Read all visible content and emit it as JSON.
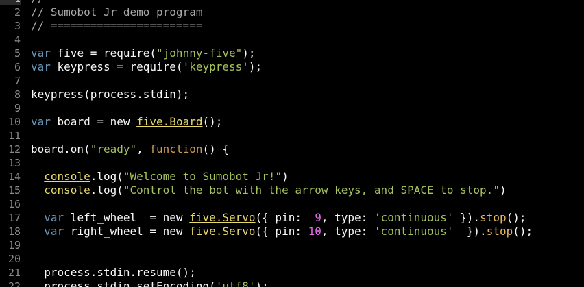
{
  "editor": {
    "lines": [
      {
        "num": "1",
        "current": true,
        "tokens": [
          {
            "text": "// =======================",
            "cls": "comment"
          }
        ]
      },
      {
        "num": "2",
        "tokens": [
          {
            "text": "// Sumobot Jr demo program",
            "cls": "comment"
          }
        ]
      },
      {
        "num": "3",
        "tokens": [
          {
            "text": "// =======================",
            "cls": "comment"
          }
        ]
      },
      {
        "num": "4",
        "tokens": []
      },
      {
        "num": "5",
        "tokens": [
          {
            "text": "var",
            "cls": "keyword"
          },
          {
            "text": " five = require(",
            "cls": "plain"
          },
          {
            "text": "\"johnny-five\"",
            "cls": "string"
          },
          {
            "text": ");",
            "cls": "plain"
          }
        ]
      },
      {
        "num": "6",
        "tokens": [
          {
            "text": "var",
            "cls": "keyword"
          },
          {
            "text": " keypress = require(",
            "cls": "plain"
          },
          {
            "text": "'keypress'",
            "cls": "string"
          },
          {
            "text": ");",
            "cls": "plain"
          }
        ]
      },
      {
        "num": "7",
        "tokens": []
      },
      {
        "num": "8",
        "tokens": [
          {
            "text": "keypress(process.stdin);",
            "cls": "plain"
          }
        ]
      },
      {
        "num": "9",
        "tokens": []
      },
      {
        "num": "10",
        "tokens": [
          {
            "text": "var",
            "cls": "keyword"
          },
          {
            "text": " board = new ",
            "cls": "plain"
          },
          {
            "text": "five.Board",
            "cls": "builtin"
          },
          {
            "text": "();",
            "cls": "plain"
          }
        ]
      },
      {
        "num": "11",
        "tokens": []
      },
      {
        "num": "12",
        "tokens": [
          {
            "text": "board.on(",
            "cls": "plain"
          },
          {
            "text": "\"ready\"",
            "cls": "string"
          },
          {
            "text": ", ",
            "cls": "plain"
          },
          {
            "text": "function",
            "cls": "func"
          },
          {
            "text": "() {",
            "cls": "plain"
          }
        ]
      },
      {
        "num": "13",
        "tokens": []
      },
      {
        "num": "14",
        "tokens": [
          {
            "text": "  ",
            "cls": "plain"
          },
          {
            "text": "console",
            "cls": "builtin"
          },
          {
            "text": ".log(",
            "cls": "plain"
          },
          {
            "text": "\"Welcome to Sumobot Jr!\"",
            "cls": "string"
          },
          {
            "text": ")",
            "cls": "plain"
          }
        ]
      },
      {
        "num": "15",
        "tokens": [
          {
            "text": "  ",
            "cls": "plain"
          },
          {
            "text": "console",
            "cls": "builtin"
          },
          {
            "text": ".log(",
            "cls": "plain"
          },
          {
            "text": "\"Control the bot with the arrow keys, and SPACE to stop.\"",
            "cls": "string"
          },
          {
            "text": ")",
            "cls": "plain"
          }
        ]
      },
      {
        "num": "16",
        "tokens": []
      },
      {
        "num": "17",
        "tokens": [
          {
            "text": "  ",
            "cls": "plain"
          },
          {
            "text": "var",
            "cls": "keyword"
          },
          {
            "text": " left_wheel  = new ",
            "cls": "plain"
          },
          {
            "text": "five.Servo",
            "cls": "builtin"
          },
          {
            "text": "({ pin:  ",
            "cls": "plain"
          },
          {
            "text": "9",
            "cls": "number"
          },
          {
            "text": ", type: ",
            "cls": "plain"
          },
          {
            "text": "'continuous'",
            "cls": "string"
          },
          {
            "text": " }).",
            "cls": "plain"
          },
          {
            "text": "stop",
            "cls": "method"
          },
          {
            "text": "();",
            "cls": "plain"
          }
        ]
      },
      {
        "num": "18",
        "tokens": [
          {
            "text": "  ",
            "cls": "plain"
          },
          {
            "text": "var",
            "cls": "keyword"
          },
          {
            "text": " right_wheel = new ",
            "cls": "plain"
          },
          {
            "text": "five.Servo",
            "cls": "builtin"
          },
          {
            "text": "({ pin: ",
            "cls": "plain"
          },
          {
            "text": "10",
            "cls": "number"
          },
          {
            "text": ", type: ",
            "cls": "plain"
          },
          {
            "text": "'continuous'",
            "cls": "string"
          },
          {
            "text": "  }).",
            "cls": "plain"
          },
          {
            "text": "stop",
            "cls": "method"
          },
          {
            "text": "();",
            "cls": "plain"
          }
        ]
      },
      {
        "num": "19",
        "tokens": []
      },
      {
        "num": "20",
        "tokens": []
      },
      {
        "num": "21",
        "tokens": [
          {
            "text": "  process.stdin.resume();",
            "cls": "plain"
          }
        ]
      },
      {
        "num": "22",
        "tokens": [
          {
            "text": "  process.stdin.setEncoding(",
            "cls": "plain"
          },
          {
            "text": "'utf8'",
            "cls": "string"
          },
          {
            "text": ");",
            "cls": "plain"
          }
        ]
      }
    ]
  }
}
